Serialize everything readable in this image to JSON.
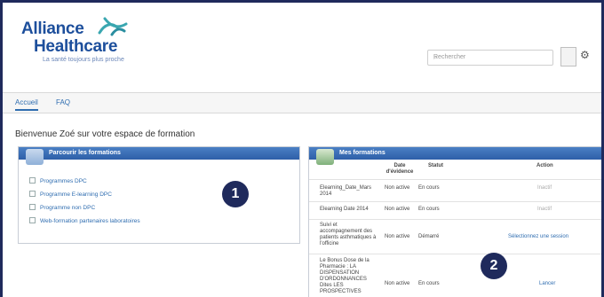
{
  "brand": {
    "line1": "Alliance",
    "line2": "Healthcare",
    "tagline": "La santé toujours plus proche",
    "colors": {
      "primary": "#1d4f9c",
      "accent": "#2f6db0",
      "frame": "#1f2a5c"
    }
  },
  "header": {
    "search_placeholder": "Rechercher",
    "search_icon": "search-icon",
    "settings_icon": "gear-icon"
  },
  "nav": {
    "tabs": [
      {
        "label": "Accueil"
      },
      {
        "label": "FAQ"
      }
    ]
  },
  "welcome": "Bienvenue Zoé sur votre espace de formation",
  "parcours": {
    "title": "Parcourir les formations",
    "links": [
      {
        "label": "Programmes DPC"
      },
      {
        "label": "Programme E-learning DPC"
      },
      {
        "label": "Programme non DPC"
      },
      {
        "label": "Web-formation partenaires laboratoires"
      }
    ]
  },
  "formations": {
    "title": "Mes formations",
    "columns": [
      "",
      "Date d'évidence",
      "Statut",
      "Action"
    ],
    "rows": [
      {
        "name": "Elearning_Date_Mars 2014",
        "state": "Non active",
        "status": "En cours",
        "action": "Inactif"
      },
      {
        "name": "Elearning Date 2014",
        "state": "Non active",
        "status": "En cours",
        "action": "Inactif"
      },
      {
        "name": "Suivi et accompagnement des patients asthmatiques à l'officine",
        "state": "Non active",
        "status": "Démarré",
        "action": "Sélectionnez une session"
      },
      {
        "name": "Le Bonus Dose de la Pharmacie : LA DISPENSATION D'ORDONNANCES Dites LES PROSPECTIVES",
        "state": "Non active",
        "status": "En cours",
        "action": "Lancer"
      }
    ]
  },
  "badges": [
    "1",
    "2"
  ]
}
